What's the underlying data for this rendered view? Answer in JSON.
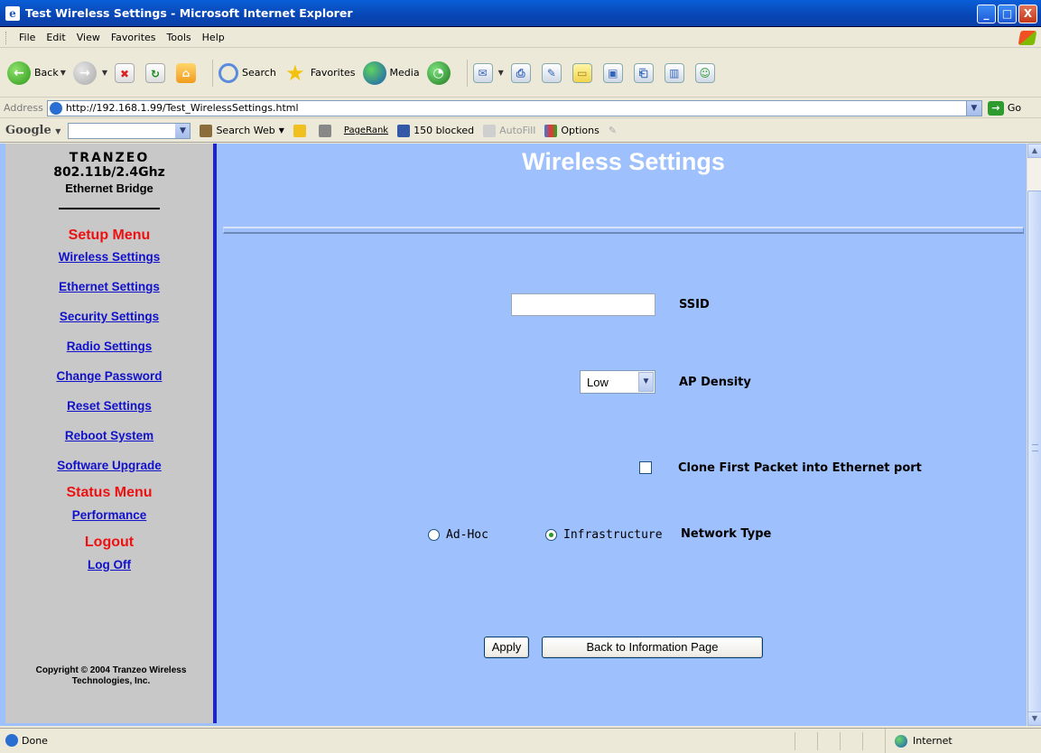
{
  "window": {
    "title": "Test Wireless Settings - Microsoft Internet Explorer",
    "buttons": [
      "_",
      "□",
      "X"
    ]
  },
  "menubar": {
    "items": [
      "File",
      "Edit",
      "View",
      "Favorites",
      "Tools",
      "Help"
    ]
  },
  "toolbar": {
    "back_label": "Back",
    "search_label": "Search",
    "favorites_label": "Favorites",
    "media_label": "Media"
  },
  "address": {
    "label": "Address",
    "url": "http://192.168.1.99/Test_WirelessSettings.html",
    "go_label": "Go"
  },
  "google": {
    "logo": "Google",
    "search_web_label": "Search Web",
    "pagerank_label": "PageRank",
    "blocked_label": "150 blocked",
    "autofill_label": "AutoFill",
    "options_label": "Options"
  },
  "sidebar": {
    "brand": "TRANZEO",
    "model": "802.11b/2.4Ghz",
    "product": "Ethernet Bridge",
    "setup_heading": "Setup Menu",
    "setup_links": [
      "Wireless Settings",
      "Ethernet Settings",
      "Security Settings",
      "Radio Settings",
      "Change Password",
      "Reset Settings",
      "Reboot System",
      "Software Upgrade"
    ],
    "status_heading": "Status Menu",
    "status_links": [
      "Performance"
    ],
    "logout_heading": "Logout",
    "logout_links": [
      "Log Off"
    ],
    "copyright": "Copyright © 2004 Tranzeo Wireless Technologies, Inc."
  },
  "main": {
    "title": "Wireless Settings",
    "ssid_label": "SSID",
    "ssid_value": "",
    "ap_density_label": "AP Density",
    "ap_density_value": "Low",
    "clone_label": "Clone First Packet into Ethernet port",
    "clone_checked": false,
    "network_type_label": "Network Type",
    "network_type_options": [
      "Ad-Hoc",
      "Infrastructure"
    ],
    "network_type_selected": "Infrastructure",
    "apply_label": "Apply",
    "back_label": "Back to Information Page"
  },
  "statusbar": {
    "status": "Done",
    "zone": "Internet"
  }
}
